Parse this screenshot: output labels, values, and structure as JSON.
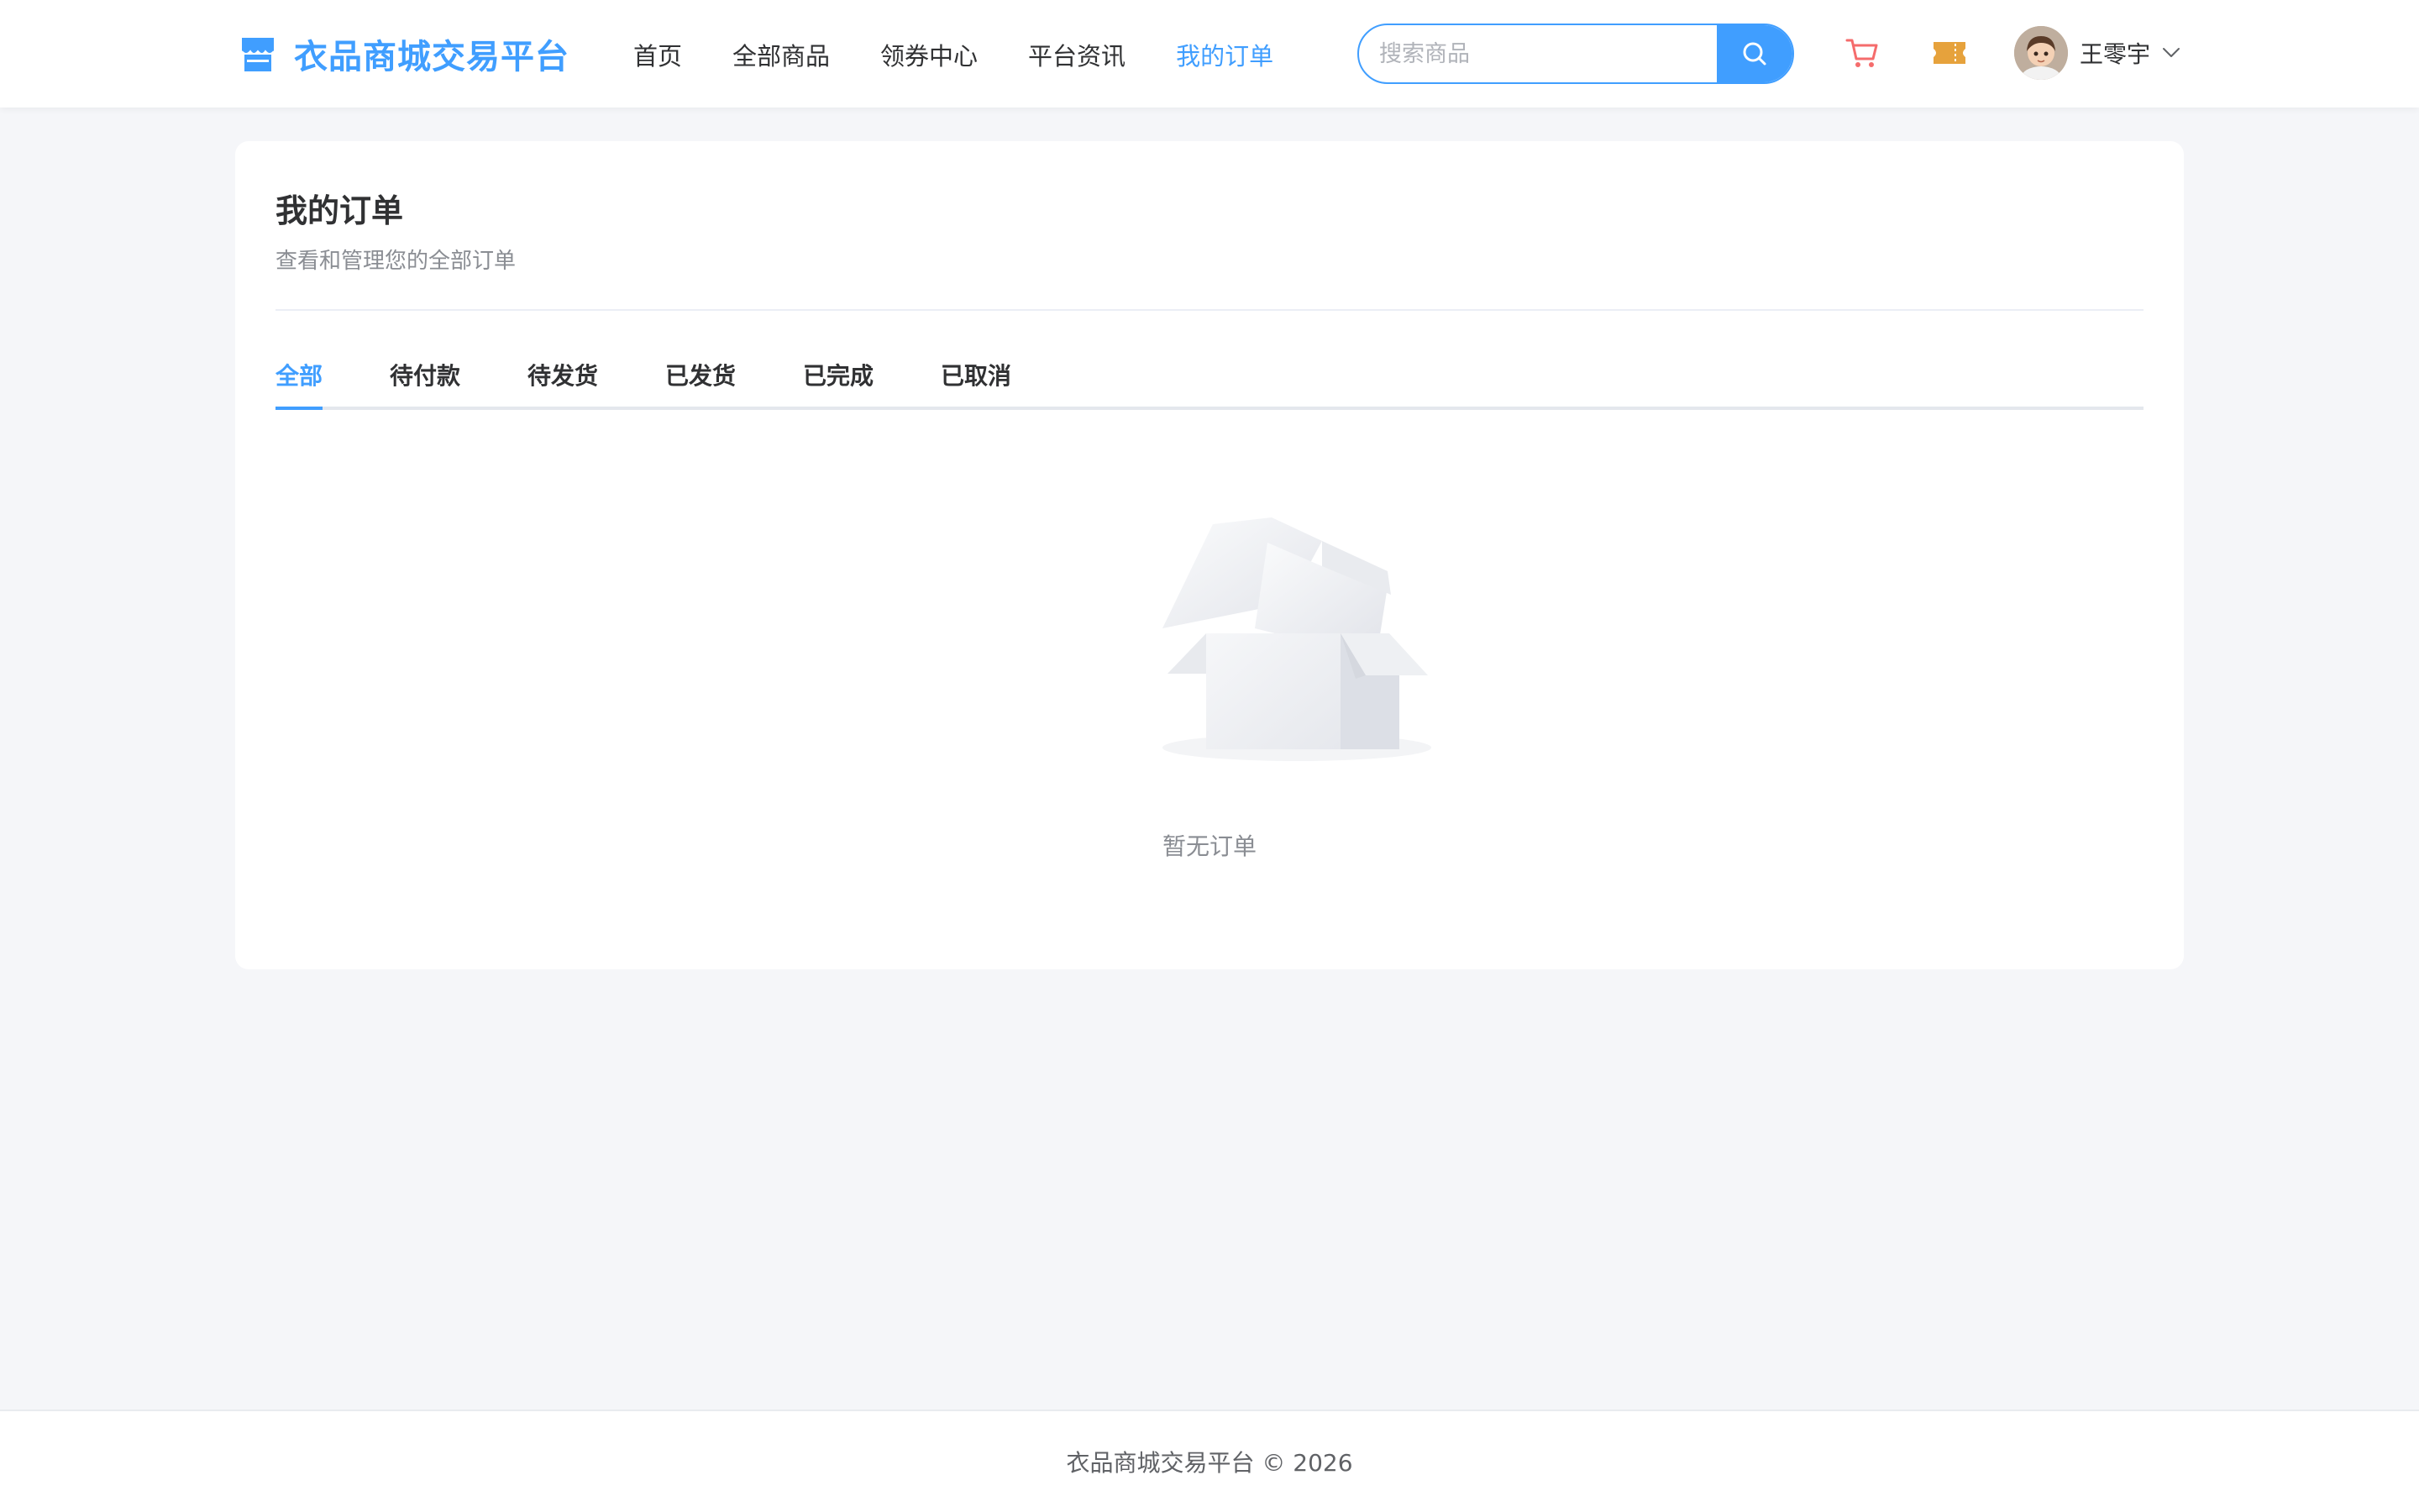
{
  "header": {
    "logo_text": "衣品商城交易平台",
    "nav": [
      {
        "label": "首页",
        "active": false
      },
      {
        "label": "全部商品",
        "active": false
      },
      {
        "label": "领券中心",
        "active": false
      },
      {
        "label": "平台资讯",
        "active": false
      },
      {
        "label": "我的订单",
        "active": true
      }
    ],
    "search": {
      "placeholder": "搜索商品",
      "value": ""
    },
    "icons": {
      "search": "search-icon",
      "cart": "cart-icon",
      "coupon": "coupon-icon",
      "dropdown": "chevron-down-icon"
    },
    "user": {
      "name": "王零宇"
    }
  },
  "main": {
    "title": "我的订单",
    "subtitle": "查看和管理您的全部订单",
    "tabs": [
      {
        "label": "全部",
        "active": true
      },
      {
        "label": "待付款",
        "active": false
      },
      {
        "label": "待发货",
        "active": false
      },
      {
        "label": "已发货",
        "active": false
      },
      {
        "label": "已完成",
        "active": false
      },
      {
        "label": "已取消",
        "active": false
      }
    ],
    "empty_text": "暂无订单"
  },
  "footer": {
    "text": "衣品商城交易平台 © 2026"
  },
  "colors": {
    "accent": "#409eff",
    "cart": "#f56c6c",
    "coupon": "#e6a23c",
    "background": "#f5f6f9"
  }
}
